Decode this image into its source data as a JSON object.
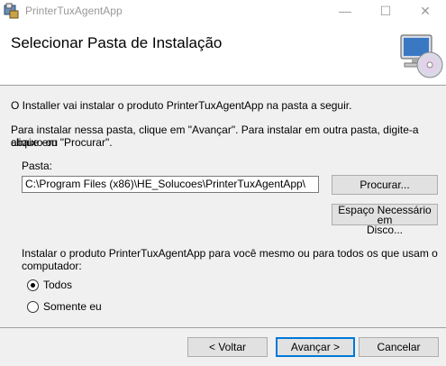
{
  "window": {
    "title": "PrinterTuxAgentApp"
  },
  "titlebar": {
    "minimize_glyph": "—",
    "maximize_glyph": "☐",
    "close_glyph": "✕"
  },
  "header": {
    "title": "Selecionar Pasta de Instalação",
    "icon": "computer-disc-icon"
  },
  "body": {
    "intro": "O Installer vai instalar o produto PrinterTuxAgentApp na pasta a seguir.",
    "instructions_line1": "Para instalar nessa pasta, clique em \"Avançar\". Para instalar em outra pasta, digite-a abaixo ou",
    "instructions_line2": "clique em \"Procurar\".",
    "folder_label": "Pasta:",
    "folder_value": "C:\\Program Files (x86)\\HE_Solucoes\\PrinterTuxAgentApp\\",
    "browse_button": "Procurar...",
    "disk_space_line1": "Espaço Necessário em",
    "disk_space_line2": "Disco...",
    "install_for_line1": "Instalar o produto PrinterTuxAgentApp para você mesmo ou para todos os que usam o",
    "install_for_line2": "computador:",
    "options": [
      {
        "label": "Todos",
        "selected": true
      },
      {
        "label": "Somente eu",
        "selected": false
      }
    ]
  },
  "footer": {
    "back": "< Voltar",
    "next": "Avançar >",
    "cancel": "Cancelar"
  }
}
